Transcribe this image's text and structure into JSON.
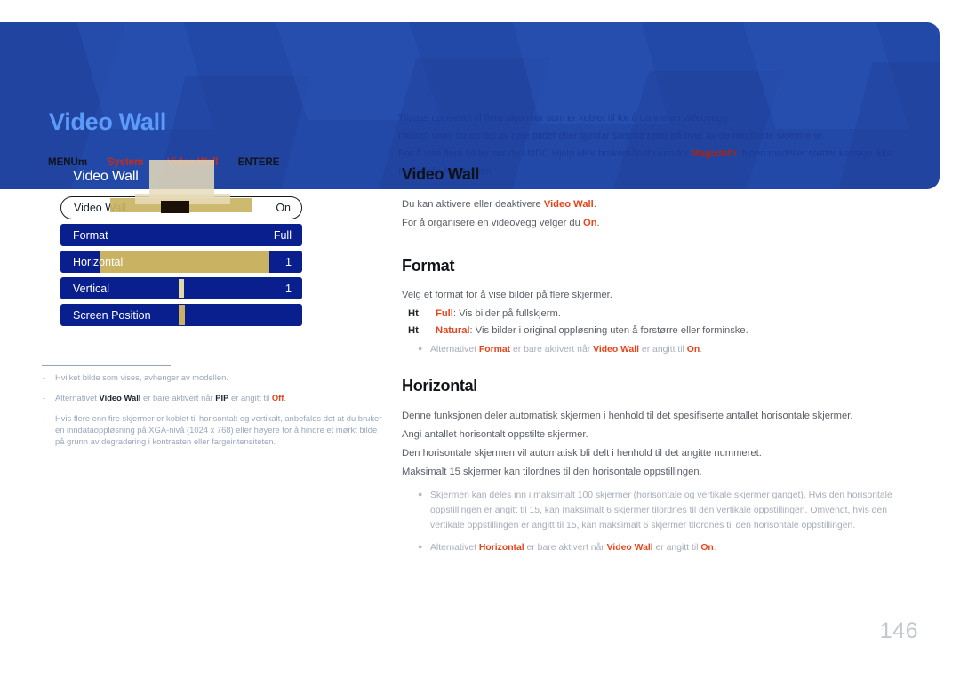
{
  "banner": {
    "title": "Video Wall",
    "breadcrumb": {
      "menu": "MENUm",
      "level1": "System",
      "level2": "Video Wall",
      "enter": "ENTERE"
    },
    "description": {
      "line1": "Tilpass oppsettet til flere skjermer som er koblet til for å danne en videovegg.",
      "line2": "I tillegg viser du en del av hele bildet eller gjentar samme bilde på hver av de tilkoblede skjermene.",
      "line3_a": "For å vise flere bilder ser du i MDC Hjelp eller brukerhåndboken for ",
      "line3_strong": "MagicInfo",
      "line3_b": ". Noen modeller støtter kanskje ikke MagicInfo-funksjonen."
    }
  },
  "osd": {
    "header": "Video Wall",
    "rows": [
      {
        "label": "Video Wall",
        "value": "On"
      },
      {
        "label": "Format",
        "value": "Full"
      },
      {
        "label": "Horizontal",
        "value": "1"
      },
      {
        "label": "Vertical",
        "value": "1"
      },
      {
        "label": "Screen Position",
        "value": ""
      }
    ]
  },
  "notes": [
    {
      "dash": "-",
      "parts": [
        {
          "t": "Hvilket bilde som vises, avhenger av modellen.",
          "s": "plain"
        }
      ]
    },
    {
      "dash": "-",
      "parts": [
        {
          "t": "Alternativet ",
          "s": "plain"
        },
        {
          "t": "Video Wall",
          "s": "bold"
        },
        {
          "t": " er bare aktivert når ",
          "s": "plain"
        },
        {
          "t": "PIP",
          "s": "bold"
        },
        {
          "t": " er angitt til ",
          "s": "plain"
        },
        {
          "t": "Off",
          "s": "red"
        },
        {
          "t": ".",
          "s": "plain"
        }
      ]
    },
    {
      "dash": "-",
      "parts": [
        {
          "t": "Hvis flere enn fire skjermer er koblet til horisontalt og vertikalt, anbefales det at du bruker en inndataoppløsning på XGA-nivå (1024 x 768) eller høyere for å hindre et mørkt bilde på grunn av degradering i kontrasten eller fargeintensiteten.",
          "s": "plain"
        }
      ]
    }
  ],
  "sections": {
    "videowall": {
      "title": "Video Wall",
      "p1_a": "Du kan aktivere eller deaktivere ",
      "p1_strong": "Video Wall",
      "p1_b": ".",
      "p2_a": "For å organisere en videovegg velger du ",
      "p2_strong": "On",
      "p2_b": "."
    },
    "format": {
      "title": "Format",
      "intro": "Velg et format for å vise bilder på flere skjermer.",
      "items": [
        {
          "mark": "Ht",
          "name": "Full",
          "text": ": Vis bilder på fullskjerm."
        },
        {
          "mark": "Ht",
          "name": "Natural",
          "text": ": Vis bilder i original oppløsning uten å forstørre eller forminske."
        }
      ],
      "note_a": "Alternativet ",
      "note_k1": "Format",
      "note_b": " er bare aktivert når ",
      "note_k2": "Video Wall",
      "note_c": " er angitt til ",
      "note_k3": "On",
      "note_d": "."
    },
    "horizontal": {
      "title": "Horizontal",
      "p1": "Denne funksjonen deler automatisk skjermen i henhold til det spesifiserte antallet horisontale skjermer.",
      "p2": "Angi antallet horisontalt oppstilte skjermer.",
      "p3": "Den horisontale skjermen vil automatisk bli delt i henhold til det angitte nummeret.",
      "p4": "Maksimalt 15 skjermer kan tilordnes til den horisontale oppstillingen.",
      "note1": "Skjermen kan deles inn i maksimalt 100 skjermer (horisontale og vertikale skjermer ganget). Hvis den horisontale oppstillingen er angitt til 15, kan maksimalt 6 skjermer tilordnes til den vertikale oppstillingen. Omvendt, hvis den vertikale oppstillingen er angitt til 15, kan maksimalt 6 skjermer tilordnes til den horisontale oppstillingen.",
      "note2_a": "Alternativet ",
      "note2_k1": "Horizontal",
      "note2_b": " er bare aktivert når ",
      "note2_k2": "Video Wall",
      "note2_c": " er angitt til ",
      "note2_k3": "On",
      "note2_d": "."
    }
  },
  "page_number": "146",
  "colors": {
    "banner_blue": "#2349a8",
    "title_blue": "#5c9bfa",
    "accent_red": "#e8441b",
    "osd_blue": "#0a1f8e",
    "overlay_tan": "#e7dcbb"
  }
}
